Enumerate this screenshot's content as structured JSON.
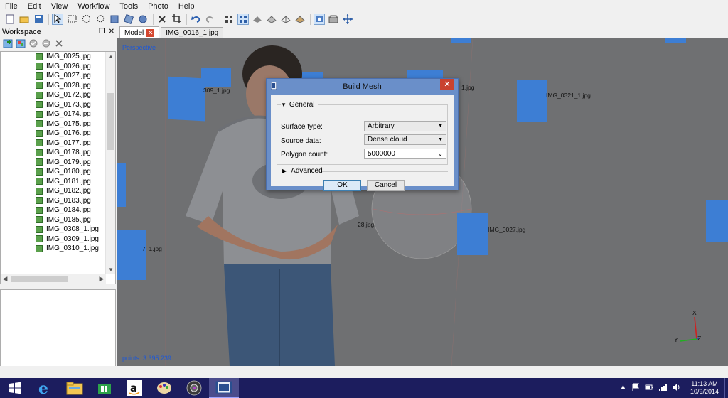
{
  "menu": [
    "File",
    "Edit",
    "View",
    "Workflow",
    "Tools",
    "Photo",
    "Help"
  ],
  "workspace": {
    "title": "Workspace",
    "items": [
      "IMG_0025.jpg",
      "IMG_0026.jpg",
      "IMG_0027.jpg",
      "IMG_0028.jpg",
      "IMG_0172.jpg",
      "IMG_0173.jpg",
      "IMG_0174.jpg",
      "IMG_0175.jpg",
      "IMG_0176.jpg",
      "IMG_0177.jpg",
      "IMG_0178.jpg",
      "IMG_0179.jpg",
      "IMG_0180.jpg",
      "IMG_0181.jpg",
      "IMG_0182.jpg",
      "IMG_0183.jpg",
      "IMG_0184.jpg",
      "IMG_0185.jpg",
      "IMG_0308_1.jpg",
      "IMG_0309_1.jpg",
      "IMG_0310_1.jpg"
    ]
  },
  "tabs": [
    {
      "label": "Model",
      "active": true,
      "closable": true
    },
    {
      "label": "IMG_0016_1.jpg",
      "active": false,
      "closable": false
    }
  ],
  "viewport": {
    "mode": "Perspective",
    "points": "points: 3 395 239",
    "camera_labels": [
      "309_1.jpg",
      "1.jpg",
      "IMG_0321_1.jpg",
      "28.jpg",
      "IMG_0027.jpg",
      "7_1.jpg"
    ],
    "axes": {
      "x": "X",
      "y": "Y",
      "z": "Z"
    }
  },
  "dialog": {
    "title": "Build Mesh",
    "general_label": "General",
    "fields": [
      {
        "label": "Surface type:",
        "value": "Arbitrary"
      },
      {
        "label": "Source data:",
        "value": "Dense cloud"
      },
      {
        "label": "Polygon count:",
        "value": "5000000"
      }
    ],
    "advanced_label": "Advanced",
    "ok": "OK",
    "cancel": "Cancel"
  },
  "taskbar": {
    "time": "11:13 AM",
    "date": "10/9/2014"
  }
}
